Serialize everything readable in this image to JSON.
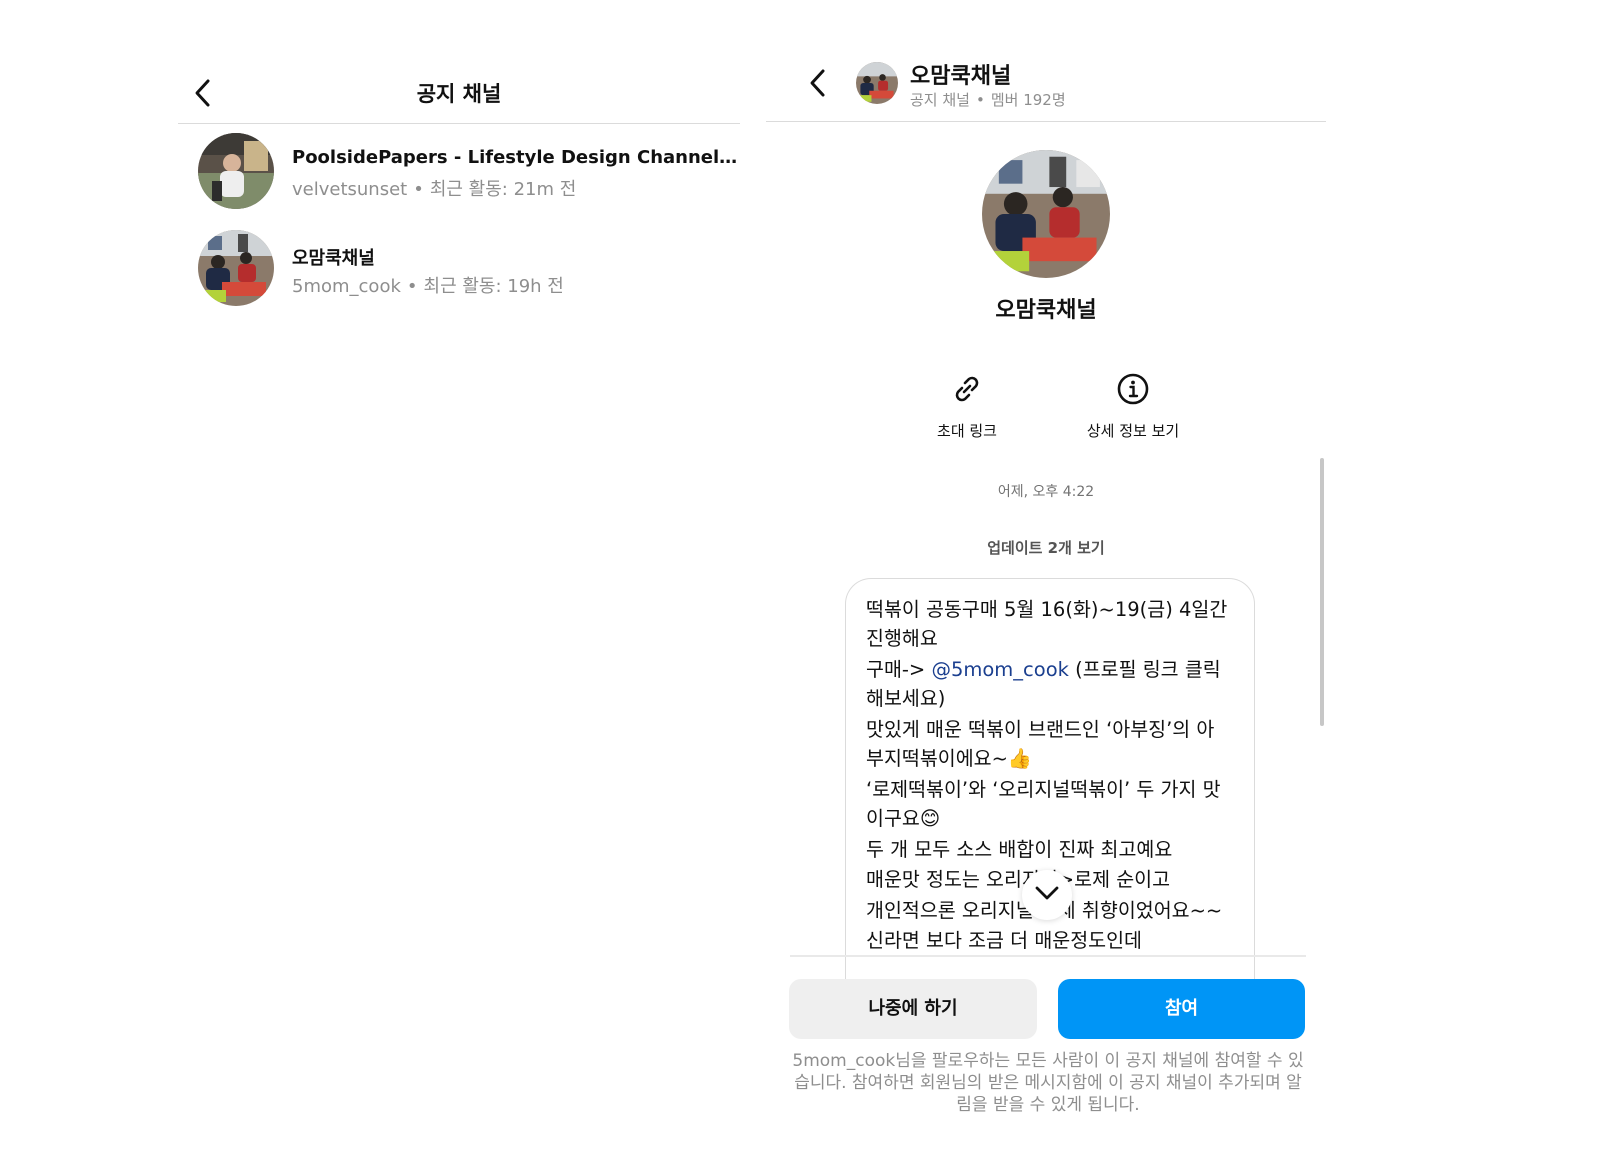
{
  "left_panel": {
    "title": "공지 채널",
    "channels": [
      {
        "name": "PoolsidePapers - Lifestyle Design Channel by...",
        "handle": "velvetsunset",
        "separator": "•",
        "activity": "최근 활동: 21m 전"
      },
      {
        "name": "오맘쿡채널",
        "handle": "5mom_cook",
        "separator": "•",
        "activity": "최근 활동: 19h 전"
      }
    ]
  },
  "right_panel": {
    "header": {
      "title": "오맘쿡채널",
      "type": "공지 채널",
      "separator": "•",
      "members": "멤버 192명"
    },
    "profile_name": "오맘쿡채널",
    "actions": {
      "invite_link": "초대 링크",
      "details": "상세 정보 보기"
    },
    "timestamp": "어제, 오후 4:22",
    "updates_link": "업데이트 2개 보기",
    "message": {
      "line1": "떡볶이 공동구매 5월 16(화)~19(금) 4일간",
      "line2": "진행해요",
      "line3_prefix": "구매-> ",
      "line3_mention": "@5mom_cook",
      "line3_suffix": " (프로필 링크 클릭",
      "line4": "해보세요)",
      "line5": "맛있게 매운 떡볶이 브랜드인 ‘아부징’의 아",
      "line6": "부지떡볶이에요~",
      "line6_emoji": "👍",
      "line7": "‘로제떡볶이’와 ‘오리지널떡볶이’ 두 가지 맛",
      "line8": "이구요",
      "line8_emoji": "😊",
      "line9": "두 개 모두 소스 배합이 진짜 최고예요",
      "line10": "매운맛 정도는 오리지널>로제 순이고",
      "line11": "개인적으론 오리지널이 제 취향이었어요~~",
      "line12": "신라면 보다 조금 더 매운정도인데"
    },
    "buttons": {
      "later": "나중에 하기",
      "join": "참여"
    },
    "footer": "5mom_cook님을 팔로우하는 모든 사람이 이 공지 채널에 참여할 수 있습니다. 참여하면 회원님의 받은 메시지함에 이 공지 채널이 추가되며 알림을 받을 수 있게 됩니다.",
    "colors": {
      "primary": "#0095f6",
      "secondary_button": "#efefef",
      "muted_text": "#8e8e8e",
      "mention": "#1b3f8f"
    }
  },
  "icons": [
    "chevron-left-icon",
    "link-icon",
    "info-icon",
    "chevron-down-icon"
  ]
}
